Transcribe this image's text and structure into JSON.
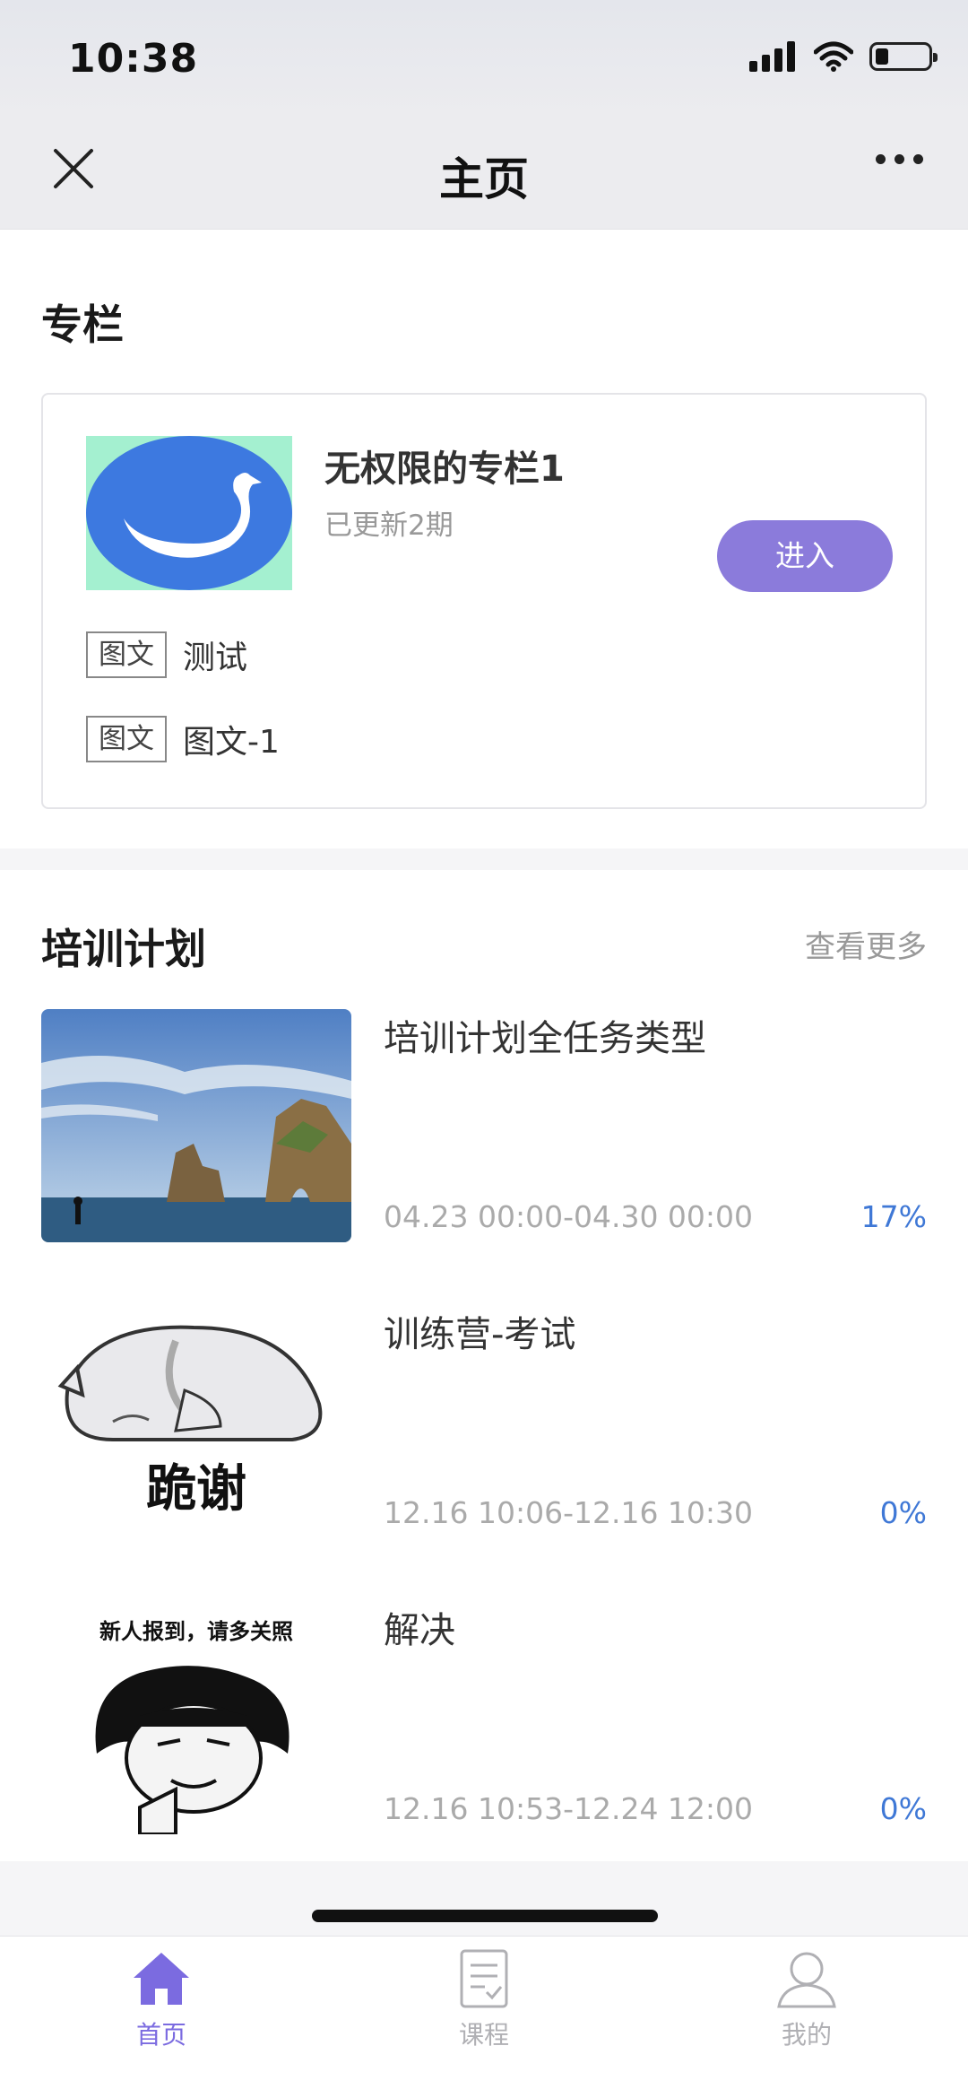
{
  "status": {
    "time": "10:38"
  },
  "nav": {
    "title": "主页"
  },
  "column_section": {
    "title": "专栏",
    "card": {
      "name": "无权限的专栏1",
      "updated": "已更新2期",
      "enter_label": "进入",
      "items": [
        {
          "tag": "图文",
          "text": "测试"
        },
        {
          "tag": "图文",
          "text": "图文-1"
        }
      ]
    }
  },
  "training_section": {
    "title": "培训计划",
    "view_more": "查看更多",
    "plans": [
      {
        "title": "培训计划全任务类型",
        "time": "04.23 00:00-04.30 00:00",
        "progress": "17%"
      },
      {
        "title": "训练营-考试",
        "time": "12.16 10:06-12.16 10:30",
        "progress": "0%",
        "thumb_text": "跪谢"
      },
      {
        "title": "解决",
        "time": "12.16 10:53-12.24 12:00",
        "progress": "0%",
        "thumb_text": "新人报到，请多关照"
      }
    ]
  },
  "tabs": [
    {
      "label": "首页",
      "active": true
    },
    {
      "label": "课程",
      "active": false
    },
    {
      "label": "我的",
      "active": false
    }
  ],
  "colors": {
    "accent": "#7b6be0",
    "button": "#8b7bdb",
    "progress": "#3f78d6",
    "inactive": "#b0b0b4"
  }
}
